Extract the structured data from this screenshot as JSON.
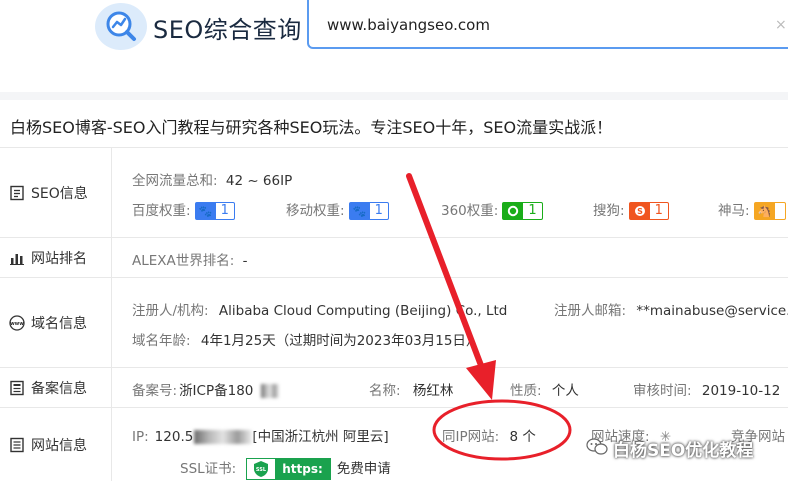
{
  "header": {
    "logo_text": "SEO综合查询",
    "search_value": "www.baiyangseo.com",
    "clear_icon": "×"
  },
  "site_title": "白杨SEO博客-SEO入门教程与研究各种SEO玩法。专注SEO十年，SEO流量实战派！",
  "seo_info": {
    "label": "SEO信息",
    "traffic_key": "全网流量总和:",
    "traffic_value": "42 ~ 66IP",
    "weights": [
      {
        "key": "百度权重:",
        "value": "1",
        "color": "#3b7cf0",
        "icon": "paw-icon"
      },
      {
        "key": "移动权重:",
        "value": "1",
        "color": "#3b7cf0",
        "icon": "paw-icon"
      },
      {
        "key": "360权重:",
        "value": "1",
        "color": "#1aad19",
        "icon": "circle-icon"
      },
      {
        "key": "搜狗:",
        "value": "1",
        "color": "#f0551f",
        "icon": "sogou-icon"
      },
      {
        "key": "神马:",
        "value": "",
        "color": "#f5a623",
        "icon": "shenma-icon"
      }
    ]
  },
  "rank": {
    "label": "网站排名",
    "alexa_key": "ALEXA世界排名:",
    "alexa_value": "-"
  },
  "domain": {
    "label": "域名信息",
    "registrant_key": "注册人/机构:",
    "registrant_value": "Alibaba Cloud Computing (Beijing) Co., Ltd",
    "email_key": "注册人邮箱:",
    "email_value": "**mainabuse@service.",
    "age_key": "域名年龄:",
    "age_value": "4年1月25天（过期时间为2023年03月15日）"
  },
  "icp": {
    "label": "备案信息",
    "icp_key": "备案号:",
    "icp_value": "浙ICP备180",
    "name_key": "名称:",
    "name_value": "杨红林",
    "type_key": "性质:",
    "type_value": "个人",
    "review_key": "审核时间:",
    "review_value": "2019-10-12"
  },
  "site": {
    "label": "网站信息",
    "ip_key": "IP:",
    "ip_value": "120.5",
    "ip_location": "[中国浙江杭州 阿里云]",
    "sameip_key": "同IP网站:",
    "sameip_value": "8 个",
    "speed_key": "网站速度:",
    "compete_key": "竞争网站",
    "ssl_key": "SSL证书:",
    "ssl_badge": "https:",
    "ssl_action": "免费申请"
  },
  "watermark": "白杨SEO优化教程",
  "colors": {
    "accent": "#5b9bf0",
    "arrow_red": "#e8202a",
    "ssl_green": "#1aa24e"
  }
}
